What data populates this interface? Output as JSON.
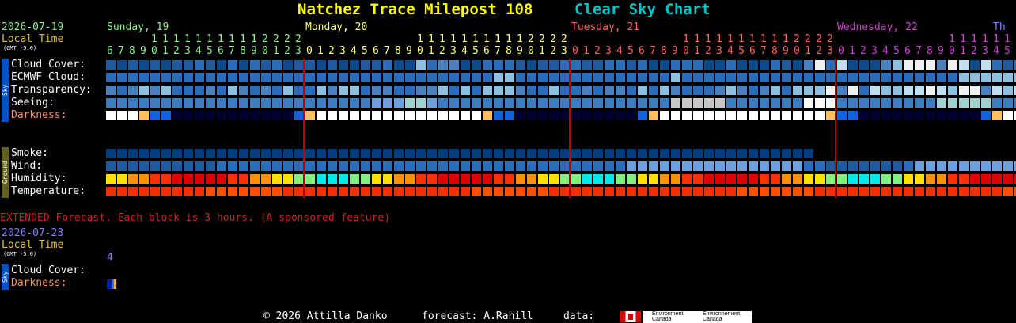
{
  "header": {
    "title": "Natchez Trace Milepost 108",
    "subtitle": "Clear Sky Chart",
    "title_color": "#ffff00",
    "subtitle_color": "#00c8c8"
  },
  "meta": {
    "date": "2026-07-19",
    "local_time": "Local Time",
    "gmt": "(GMT -5.0)"
  },
  "days": [
    {
      "label": "Sunday, 19",
      "color": "#90ee90"
    },
    {
      "label": "Monday, 20",
      "color": "#ffff80"
    },
    {
      "label": "Tuesday, 21",
      "color": "#ff6060"
    },
    {
      "label": "Wednesday, 22",
      "color": "#d040d0"
    },
    {
      "label": "Th",
      "color": "#8080ff"
    }
  ],
  "hours": {
    "start": 6,
    "count": 84,
    "day_colors": [
      "#90ee90",
      "#ffff80",
      "#ff6060",
      "#d040d0",
      "#8080ff"
    ],
    "boundaries": [
      18,
      42,
      66
    ]
  },
  "sky_tab": "Sky",
  "ground_tab": "Ground",
  "rows": {
    "sky": [
      "Cloud Cover:",
      "ECMWF Cloud:",
      "Transparency:",
      "Seeing:",
      "Darkness:"
    ],
    "ground": [
      "Smoke:",
      "Wind:",
      "Humidity:",
      "Temperature:"
    ]
  },
  "extended": {
    "notice": "EXTENDED Forecast. Each block is 3 hours. (A sponsored feature)",
    "date": "2026-07-23",
    "local_time": "Local Time",
    "gmt": "(GMT -5.0)",
    "hour": "4",
    "rows": [
      "Cloud Cover:",
      "Darkness:"
    ]
  },
  "footer": {
    "copyright": "© 2026 Attilla Danko",
    "forecast": "forecast: A.Rahill",
    "data": "data:",
    "env_en": "Environment Canada",
    "env_fr": "Environnement Canada"
  },
  "colors": {
    "cloud_clear": "#003e7e",
    "cloud_mid": "#4a80c0",
    "cloud_white": "#f0f0f0",
    "transp_good": "#2c6cbc",
    "seeing_mid": "#3c7cc0",
    "dark_black": "#000000",
    "dark_blue": "#0050d0",
    "dark_white": "#ffffff",
    "humid_cyan": "#00e8e8",
    "temp_red": "#f03000"
  },
  "chart_data": {
    "type": "heatmap",
    "cloud_cover": "0000000000000000000000000000000000000000000000000000000000000000000000000000000000000000000000000",
    "darkness_pattern": "WWWYBBKKKKKKKKKKKBYWWWWWWWWWWWWWWWYBBKKKKKKKKKKKBYWWWWWWWWWWWWWWWYBBKKKKKKKKKKKBYWWWWWWWWWWWWWWWYBBKKKK"
  }
}
